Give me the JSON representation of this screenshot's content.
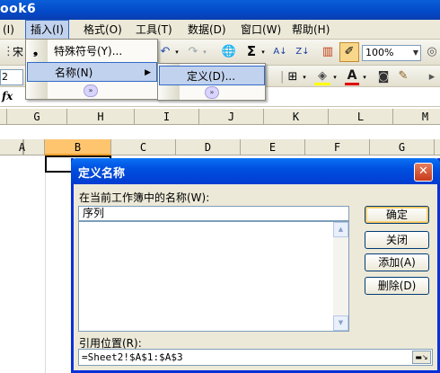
{
  "window": {
    "title": "ook6"
  },
  "menubar": {
    "items": [
      {
        "label": "(I)"
      },
      {
        "label": "插入(I)"
      },
      {
        "label": "格式(O)"
      },
      {
        "label": "工具(T)"
      },
      {
        "label": "数据(D)"
      },
      {
        "label": "窗口(W)"
      },
      {
        "label": "帮助(H)"
      }
    ]
  },
  "toolbar": {
    "zoom": "100%",
    "namebox_fragment": "2",
    "fx_label": "fx",
    "partial_label": "宋"
  },
  "insert_menu": {
    "items": [
      {
        "label": "特殊符号(Y)..."
      },
      {
        "label": "名称(N)"
      }
    ]
  },
  "name_submenu": {
    "items": [
      {
        "label": "定义(D)..."
      }
    ]
  },
  "columns_top": [
    "G",
    "H",
    "I",
    "J",
    "K",
    "L",
    "M"
  ],
  "columns_bottom": [
    "A",
    "B",
    "C",
    "D",
    "E",
    "F",
    "G"
  ],
  "dialog": {
    "title": "定义名称",
    "names_label": "在当前工作簿中的名称(W):",
    "name_value": "序列",
    "refers_label": "引用位置(R):",
    "refers_value": "=Sheet2!$A$1:$A$3",
    "buttons": {
      "ok": "确定",
      "close": "关闭",
      "add": "添加(A)",
      "delete": "删除(D)"
    },
    "close_glyph": "✕"
  }
}
